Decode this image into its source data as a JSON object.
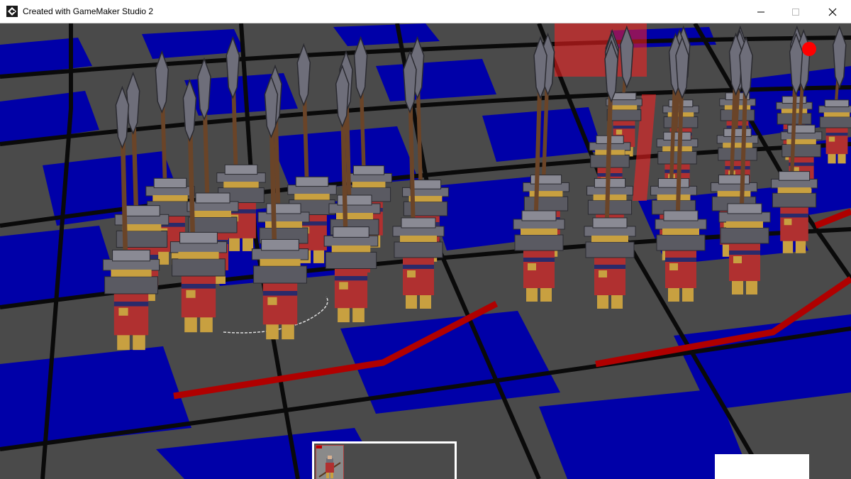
{
  "window": {
    "title": "Created with GameMaker Studio 2",
    "controls": [
      "minimize-icon",
      "maximize-icon",
      "close-icon"
    ]
  },
  "game": {
    "board": {
      "tile_dark": "#4a4a4a",
      "tile_blue": "#0000a8",
      "grid_line": "#0a0a0a"
    },
    "units": {
      "left_formation": {
        "count": 12,
        "type": "spearman"
      },
      "right_formation": {
        "count": 16,
        "type": "spearman"
      },
      "armor_color": "#6e6e78",
      "robe_color": "#b03030",
      "boot_color": "#c8a040"
    },
    "markers": {
      "selection_line_color": "#b00000",
      "red_dot_color": "#ff0000",
      "red_highlight_color": "#ff2020"
    },
    "hud": {
      "unit_card": {
        "health_fraction": 0.22,
        "health_color": "#c00000",
        "border_color": "#ffffff"
      },
      "info_panel_color": "#ffffff"
    }
  }
}
